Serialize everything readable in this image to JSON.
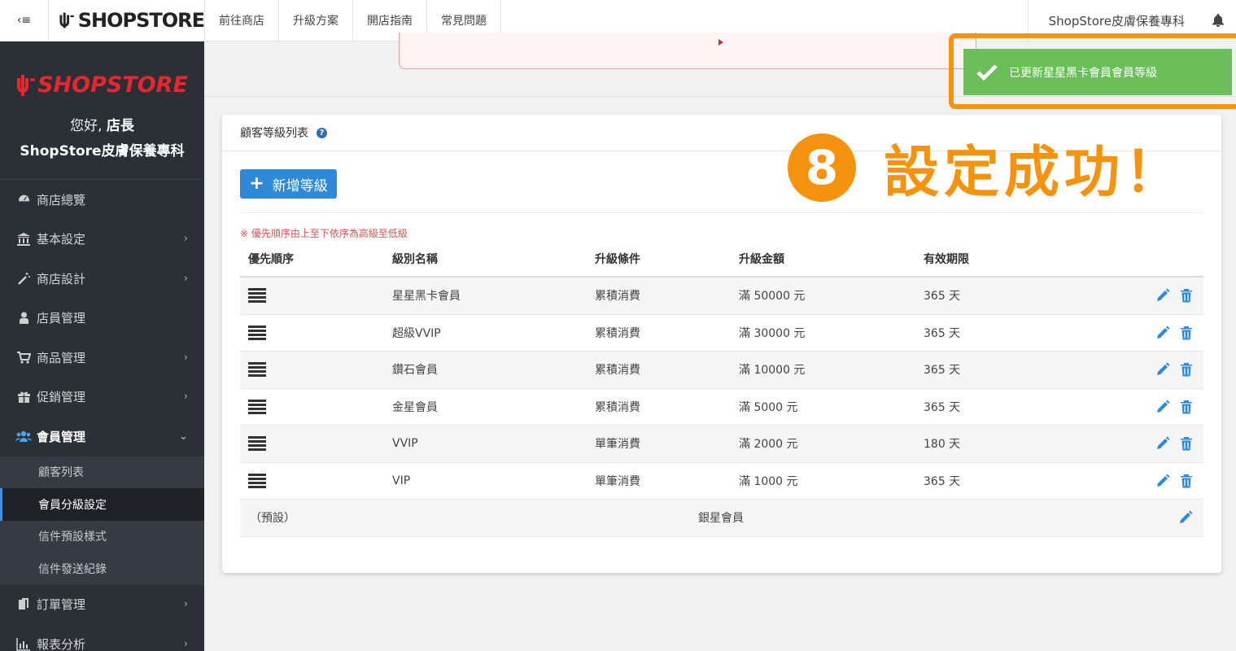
{
  "topbar": {
    "toggle_glyph": "‹≡",
    "logo_text": "SHOPSTORE",
    "links": [
      "前往商店",
      "升級方案",
      "開店指南",
      "常見問題"
    ],
    "store_name": "ShopStore皮膚保養專科"
  },
  "sidebar": {
    "logo_text": "SHOPSTORE",
    "greeting_prefix": "您好, ",
    "greeting_name": "店長",
    "store_name": "ShopStore皮膚保養專科",
    "items": [
      {
        "label": "商店總覽",
        "icon": "dashboard-icon",
        "chevron": ""
      },
      {
        "label": "基本設定",
        "icon": "bank-icon",
        "chevron": "›"
      },
      {
        "label": "商店設計",
        "icon": "magic-wand-icon",
        "chevron": "›"
      },
      {
        "label": "店員管理",
        "icon": "user-lock-icon",
        "chevron": ""
      },
      {
        "label": "商品管理",
        "icon": "cart-icon",
        "chevron": "›"
      },
      {
        "label": "促銷管理",
        "icon": "gift-icon",
        "chevron": "›"
      },
      {
        "label": "會員管理",
        "icon": "users-icon",
        "chevron": "⌄"
      }
    ],
    "sub_items": [
      "顧客列表",
      "會員分級設定",
      "信件預設樣式",
      "信件發送紀錄"
    ],
    "bottom_items": [
      {
        "label": "訂單管理",
        "icon": "copy-icon",
        "chevron": "›"
      },
      {
        "label": "報表分析",
        "icon": "bar-chart-icon",
        "chevron": "›"
      }
    ]
  },
  "panel": {
    "title": "顧客等級列表",
    "help": "?",
    "add_button": "新增等級",
    "add_plus": "+",
    "note": "※ 優先順序由上至下依序為高級至低級",
    "columns": [
      "優先順序",
      "級別名稱",
      "升級條件",
      "升級金額",
      "有效期限"
    ],
    "rows": [
      {
        "name": "星星黑卡會員",
        "condition": "累積消費",
        "amount": "滿 50000 元",
        "period": "365 天"
      },
      {
        "name": "超級VVIP",
        "condition": "累積消費",
        "amount": "滿 30000 元",
        "period": "365 天"
      },
      {
        "name": "鑽石會員",
        "condition": "累積消費",
        "amount": "滿 10000 元",
        "period": "365 天"
      },
      {
        "name": "金星會員",
        "condition": "累積消費",
        "amount": "滿 5000 元",
        "period": "365 天"
      },
      {
        "name": "VVIP",
        "condition": "單筆消費",
        "amount": "滿 2000 元",
        "period": "180 天"
      },
      {
        "name": "VIP",
        "condition": "單筆消費",
        "amount": "滿 1000 元",
        "period": "365 天"
      }
    ],
    "default_row": {
      "label": "（預設）",
      "name": "銀星會員"
    }
  },
  "toast": {
    "message": "已更新星星黑卡會員會員等級"
  },
  "callout": {
    "number": "8",
    "text": "設定成功！"
  },
  "colors": {
    "accent": "#2e8ad8",
    "success": "#6abf5b",
    "highlight": "#f5930f",
    "sidebar": "#2b2f36",
    "brand_red": "#e8262d"
  }
}
